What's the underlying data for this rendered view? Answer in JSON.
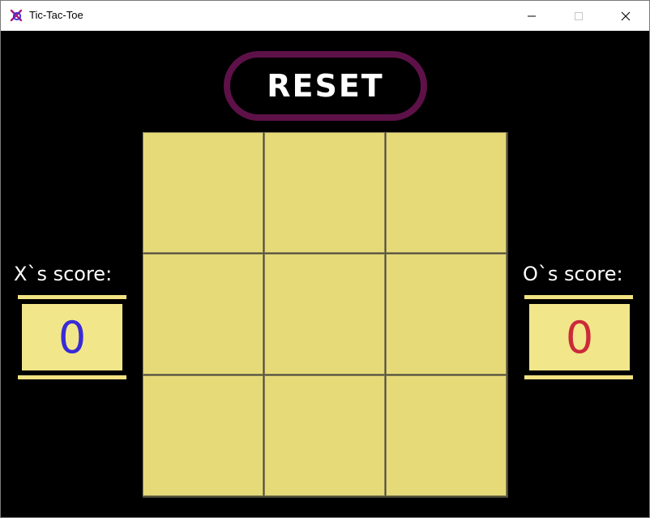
{
  "window": {
    "title": "Tic-Tac-Toe",
    "icon": "tictactoe-app-icon",
    "controls": [
      "minimize",
      "maximize",
      "close"
    ]
  },
  "reset": {
    "label": "RESET"
  },
  "board": {
    "cells": [
      "",
      "",
      "",
      "",
      "",
      "",
      "",
      "",
      ""
    ]
  },
  "scores": {
    "x": {
      "title": "X`s score:",
      "value": "0",
      "color": "#3a2bd6"
    },
    "o": {
      "title": "O`s score:",
      "value": "0",
      "color": "#cc2a3a"
    }
  },
  "colors": {
    "background": "#000000",
    "board_cell": "#e6da78",
    "reset_border": "#5e1148",
    "score_box": "#f2e68a"
  }
}
